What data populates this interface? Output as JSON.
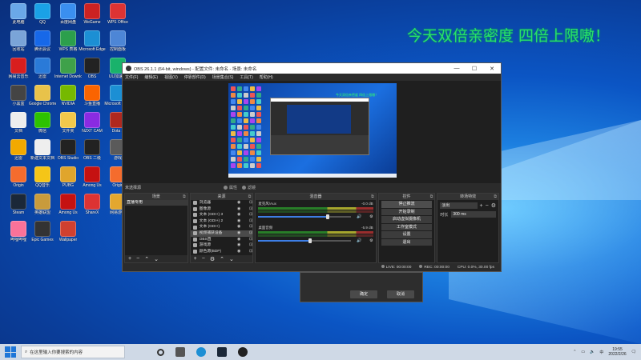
{
  "desktop": {
    "headline": "今天双倍亲密度 四倍上限嗷！",
    "icons": [
      {
        "label": "此电脑",
        "color": "#6aa8e8"
      },
      {
        "label": "QQ",
        "color": "#1aa1e6"
      },
      {
        "label": "百度网盘",
        "color": "#3a8ff0"
      },
      {
        "label": "WeGame",
        "color": "#c22"
      },
      {
        "label": "WPS Office",
        "color": "#d33"
      },
      {
        "label": "回收站",
        "color": "#7aa4d8"
      },
      {
        "label": "腾讯会议",
        "color": "#1768e8"
      },
      {
        "label": "WPS 表格",
        "color": "#2c9f4c"
      },
      {
        "label": "Microsoft Edge",
        "color": "#1c8fd4"
      },
      {
        "label": "控制面板",
        "color": "#4d86d6"
      },
      {
        "label": "网易云音乐",
        "color": "#d81e1e"
      },
      {
        "label": "迅雷",
        "color": "#2a7ad8"
      },
      {
        "label": "Internet Download",
        "color": "#3fa14a"
      },
      {
        "label": "OBS",
        "color": "#222"
      },
      {
        "label": "UU加速器",
        "color": "#19b26b"
      },
      {
        "label": "小黑盒",
        "color": "#444"
      },
      {
        "label": "Google Chrome",
        "color": "#e8c24a"
      },
      {
        "label": "NVIDIA",
        "color": "#76b900"
      },
      {
        "label": "斗鱼直播",
        "color": "#fa6400"
      },
      {
        "label": "Microsoft Edge",
        "color": "#1c8fd4"
      },
      {
        "label": "文档",
        "color": "#eeeeee"
      },
      {
        "label": "微信",
        "color": "#2dc100"
      },
      {
        "label": "文件夹",
        "color": "#f2c84b"
      },
      {
        "label": "NZXT CAM",
        "color": "#8a2be2"
      },
      {
        "label": "Dota 2",
        "color": "#b0281f"
      },
      {
        "label": "迅雷",
        "color": "#f2a900"
      },
      {
        "label": "新建文本文档",
        "color": "#eeeeee"
      },
      {
        "label": "OBS Studio",
        "color": "#222"
      },
      {
        "label": "OBS 二级",
        "color": "#222"
      },
      {
        "label": "游戏",
        "color": "#5a5a5a"
      },
      {
        "label": "Origin",
        "color": "#f56c2d"
      },
      {
        "label": "QQ音乐",
        "color": "#f5c518"
      },
      {
        "label": "PUBG",
        "color": "#e0a52c"
      },
      {
        "label": "Among Us",
        "color": "#c51111"
      },
      {
        "label": "Origin",
        "color": "#f56c2d"
      },
      {
        "label": "Steam",
        "color": "#1b2838"
      },
      {
        "label": "英雄联盟",
        "color": "#c89b3c"
      },
      {
        "label": "Among Us",
        "color": "#c51111"
      },
      {
        "label": "ShareX",
        "color": "#d33"
      },
      {
        "label": "网易游戏",
        "color": "#e3a72f"
      },
      {
        "label": "哔哩哔哩",
        "color": "#fb7299"
      },
      {
        "label": "Epic Games",
        "color": "#333"
      },
      {
        "label": "Wallpaper",
        "color": "#d04030"
      }
    ]
  },
  "obs": {
    "title": "OBS 26.1.1 (64-bit, windows) - 配置文件: 未命名 - 场景: 未命名",
    "window_buttons": {
      "min": "—",
      "max": "☐",
      "close": "✕"
    },
    "menu": [
      "文件(F)",
      "编辑(E)",
      "视图(V)",
      "停靠部件(D)",
      "场景集合(S)",
      "工具(T)",
      "帮助(H)"
    ],
    "preview_overlay_text": "今天双倍亲密度 四倍上限嗷！",
    "no_source": "未选择源",
    "properties_btn": "属性",
    "filters_btn": "滤镜",
    "docks": {
      "scenes": {
        "title": "场景",
        "items": [
          "直播专用"
        ]
      },
      "sources": {
        "title": "来源",
        "items": [
          "浏览器",
          "图像源",
          "文本 (GDI+) 3",
          "文本 (GDI+) 2",
          "文本 (GDI+)",
          "视频捕获设备",
          "OBS直",
          "游戏源",
          "颜色源(BDP)"
        ]
      },
      "mixer": {
        "title": "混音器",
        "channels": [
          {
            "name": "麦克风/Aux",
            "db": "-0.0 dB",
            "level": 0.75
          },
          {
            "name": "桌面音频",
            "db": "-5.9 dB",
            "level": 0.56
          }
        ]
      },
      "controls": {
        "title": "控件",
        "buttons": [
          "停止推流",
          "开始录制",
          "启动虚拟摄像机",
          "工作室模式",
          "设置",
          "退出"
        ]
      },
      "transitions": {
        "title": "转场特效",
        "selected": "淡出",
        "duration_label": "时长",
        "duration_value": "300 ms"
      }
    },
    "status_bar": {
      "live": "LIVE: 00:00:00",
      "rec": "REC: 00:00:00",
      "cpu": "CPU: 0.0%, 30.00 fps"
    }
  },
  "dialog": {
    "btn_left": "确定",
    "btn_right": "取消"
  },
  "taskbar": {
    "search_placeholder": "在这里输入你要搜索的内容",
    "time": "19:55",
    "date": "2022/2/26"
  }
}
